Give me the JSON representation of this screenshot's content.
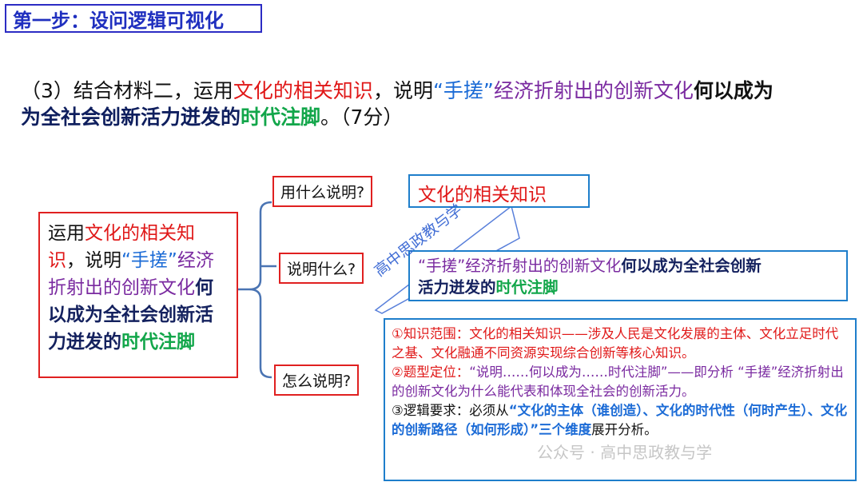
{
  "title": "第一步：设问逻辑可视化",
  "question": {
    "prefix": "（3）结合材料二，运用",
    "knowledge": "文化的相关知识",
    "mid1": "，说明",
    "quote": "“手搓”",
    "mid2": "经济折射出的创新文化",
    "bold1": "何以成为",
    "line2_bold": "为全社会创新活力迸发的",
    "line2_green": "时代注脚",
    "line2_end": "。（7分）"
  },
  "left_box": {
    "t1": "运用",
    "t2": "文化的相关知识",
    "t3": "，说明",
    "t4": "“手搓”",
    "t5": "经济折射出的创新文化",
    "t6": "何以成为全社会创新活力迸发的",
    "t7": "时代注脚"
  },
  "labels": {
    "use_what": "用什么说明?",
    "explain_what": "说明什么?",
    "how_explain": "怎么说明?"
  },
  "answers": {
    "a1": "文化的相关知识",
    "a2_purple": "“手搓”经济折射出的创新文化",
    "a2_bold": "何以成为全社会创新",
    "a2_line2_bold": "活力迸发的",
    "a2_line2_green": "时代注脚"
  },
  "how": {
    "p1_label": "①知识范围：",
    "p1_text": "文化的相关知识——涉及人民是文化发展的主体、文化立足时代之基、文化融通不同资源实现综合创新等核心知识。",
    "p2_label": "②题型定位：",
    "p2_text1": "“说明……何以成为……时代注脚”——即分析",
    "p2_text2": "“手搓”经济折射出的创新文化为什么能代表和体现全社会的创新活力。",
    "p3_label": "③逻辑要求：必须从",
    "p3_blue": "“文化的主体（谁创造）、文化的时代性（何时产生）、文化的创新路径（如何形成）”三个维度",
    "p3_end": "展开分析。"
  },
  "watermark": "高中思政教与学",
  "watermark2": "公众号 · 高中思政教与学"
}
